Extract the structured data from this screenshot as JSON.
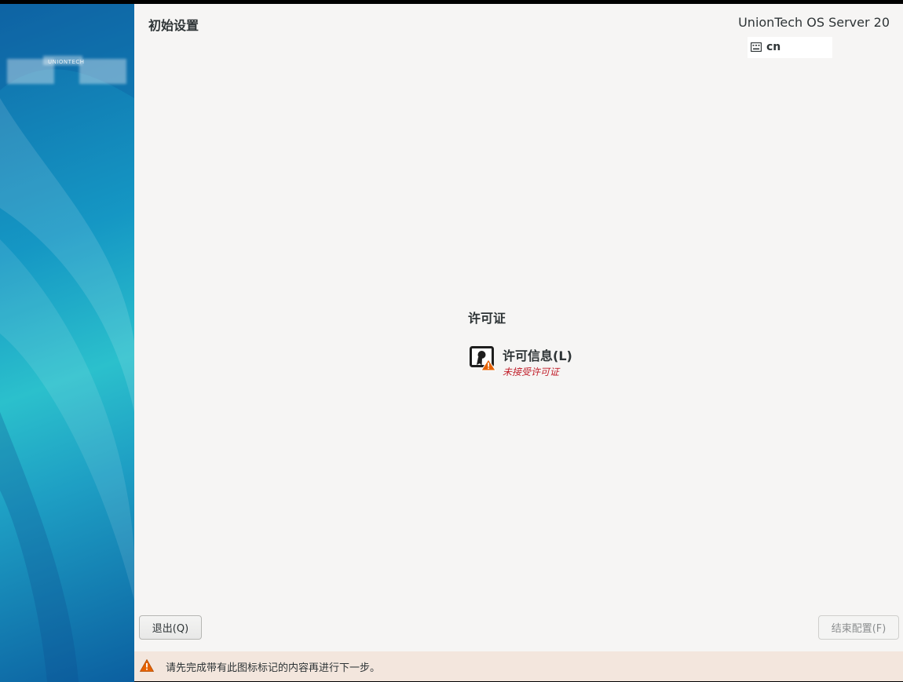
{
  "header": {
    "page_title": "初始设置",
    "product_name": "UnionTech OS Server 20",
    "keyboard_layout": "cn",
    "keyboard_icon": "keyboard-icon"
  },
  "sidebar": {
    "logo_text": "UNIONTECH"
  },
  "main": {
    "section_title": "许可证",
    "spokes": [
      {
        "title": "许可信息(L)",
        "status": "未接受许可证",
        "icon": "license-warning-icon"
      }
    ]
  },
  "footer": {
    "quit_label": "退出(Q)",
    "finish_label": "结束配置(F)",
    "finish_enabled": false
  },
  "warning_bar": {
    "icon": "warning-icon",
    "text": "请先完成带有此图标标记的内容再进行下一步。"
  },
  "colors": {
    "background": "#f6f5f4",
    "status_error": "#c01c28",
    "warning_bar_bg": "#f3e6dd",
    "warning_icon": "#e66100"
  }
}
